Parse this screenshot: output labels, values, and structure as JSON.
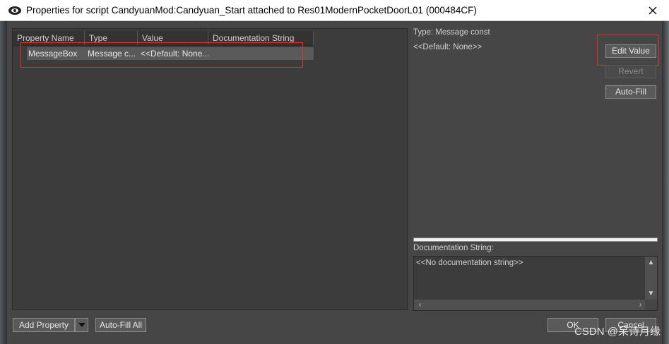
{
  "window": {
    "title": "Properties for script CandyuanMod:Candyuan_Start attached to Res01ModernPocketDoorL01 (000484CF)"
  },
  "table": {
    "columns": [
      "Property Name",
      "Type",
      "Value",
      "Documentation String"
    ],
    "rows": [
      {
        "name": "MessageBox",
        "type": "Message c...",
        "value": "<<Default: None...",
        "doc": ""
      }
    ]
  },
  "details": {
    "type_text": "Type: Message const",
    "value_text": "<<Default: None>>",
    "edit_value_label": "Edit Value",
    "revert_label": "Revert",
    "auto_fill_label": "Auto-Fill",
    "doc_label": "Documentation String:",
    "doc_text": "<<No documentation string>>"
  },
  "footer": {
    "add_property_label": "Add Property",
    "auto_fill_all_label": "Auto-Fill All",
    "ok_label": "OK",
    "cancel_label": "Cancel"
  },
  "watermark": "CSDN @呆诗月缘",
  "colors": {
    "highlight_box": "#e03030",
    "dialog_bg": "#464646",
    "button_bg": "#5a5a5a"
  }
}
